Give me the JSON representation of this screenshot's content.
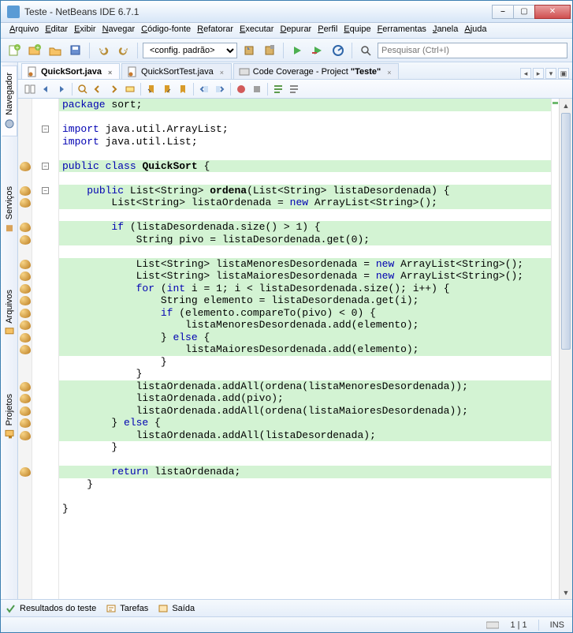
{
  "window_title": "Teste - NetBeans IDE 6.7.1",
  "menu": [
    "Arquivo",
    "Editar",
    "Exibir",
    "Navegar",
    "Código-fonte",
    "Refatorar",
    "Executar",
    "Depurar",
    "Perfil",
    "Equipe",
    "Ferramentas",
    "Janela",
    "Ajuda"
  ],
  "config_label": "<config. padrão>",
  "search_placeholder": "Pesquisar (Ctrl+I)",
  "side_tabs": [
    "Navegador",
    "Serviços",
    "Arquivos",
    "Projetos"
  ],
  "editor_tabs": [
    {
      "label": "QuickSort.java",
      "active": true
    },
    {
      "label": "QuickSortTest.java",
      "active": false
    },
    {
      "label": "Code Coverage - Project \"Teste\"",
      "active": false,
      "rich_prefix": "Code Coverage - Project ",
      "rich_bold": "\"Teste\""
    }
  ],
  "bottom_tabs": [
    "Resultados do teste",
    "Tarefas",
    "Saída"
  ],
  "status": {
    "pos": "1 | 1",
    "mode": "INS"
  },
  "code_lines": [
    {
      "hl": true,
      "tokens": [
        [
          "kw",
          "package"
        ],
        [
          "",
          " sort;"
        ]
      ]
    },
    {
      "hl": false,
      "tokens": [
        [
          "",
          ""
        ]
      ]
    },
    {
      "hl": false,
      "tokens": [
        [
          "kw",
          "import"
        ],
        [
          "",
          " java.util.ArrayList;"
        ]
      ]
    },
    {
      "hl": false,
      "tokens": [
        [
          "kw",
          "import"
        ],
        [
          "",
          " java.util.List;"
        ]
      ]
    },
    {
      "hl": false,
      "tokens": [
        [
          "",
          ""
        ]
      ]
    },
    {
      "hl": true,
      "tokens": [
        [
          "kw",
          "public"
        ],
        [
          "",
          " "
        ],
        [
          "kw",
          "class"
        ],
        [
          "",
          " "
        ],
        [
          "cls",
          "QuickSort"
        ],
        [
          "",
          " {"
        ]
      ]
    },
    {
      "hl": false,
      "tokens": [
        [
          "",
          ""
        ]
      ]
    },
    {
      "hl": true,
      "tokens": [
        [
          "",
          "    "
        ],
        [
          "kw",
          "public"
        ],
        [
          "",
          " List<String> "
        ],
        [
          "cls",
          "ordena"
        ],
        [
          "",
          "(List<String> listaDesordenada) {"
        ]
      ]
    },
    {
      "hl": true,
      "tokens": [
        [
          "",
          "        List<String> listaOrdenada = "
        ],
        [
          "kw",
          "new"
        ],
        [
          "",
          " ArrayList<String>();"
        ]
      ]
    },
    {
      "hl": false,
      "tokens": [
        [
          "",
          ""
        ]
      ]
    },
    {
      "hl": true,
      "tokens": [
        [
          "",
          "        "
        ],
        [
          "kw",
          "if"
        ],
        [
          "",
          " (listaDesordenada.size() > 1) {"
        ]
      ]
    },
    {
      "hl": true,
      "tokens": [
        [
          "",
          "            String pivo = listaDesordenada.get(0);"
        ]
      ]
    },
    {
      "hl": false,
      "tokens": [
        [
          "",
          ""
        ]
      ]
    },
    {
      "hl": true,
      "tokens": [
        [
          "",
          "            List<String> listaMenoresDesordenada = "
        ],
        [
          "kw",
          "new"
        ],
        [
          "",
          " ArrayList<String>();"
        ]
      ]
    },
    {
      "hl": true,
      "tokens": [
        [
          "",
          "            List<String> listaMaioresDesordenada = "
        ],
        [
          "kw",
          "new"
        ],
        [
          "",
          " ArrayList<String>();"
        ]
      ]
    },
    {
      "hl": true,
      "tokens": [
        [
          "",
          "            "
        ],
        [
          "kw",
          "for"
        ],
        [
          "",
          " ("
        ],
        [
          "kw",
          "int"
        ],
        [
          "",
          " i = 1; i < listaDesordenada.size(); i++) {"
        ]
      ]
    },
    {
      "hl": true,
      "tokens": [
        [
          "",
          "                String elemento = listaDesordenada.get(i);"
        ]
      ]
    },
    {
      "hl": true,
      "tokens": [
        [
          "",
          "                "
        ],
        [
          "kw",
          "if"
        ],
        [
          "",
          " (elemento.compareTo(pivo) < 0) {"
        ]
      ]
    },
    {
      "hl": true,
      "tokens": [
        [
          "",
          "                    listaMenoresDesordenada.add(elemento);"
        ]
      ]
    },
    {
      "hl": true,
      "tokens": [
        [
          "",
          "                } "
        ],
        [
          "kw",
          "else"
        ],
        [
          "",
          " {"
        ]
      ]
    },
    {
      "hl": true,
      "tokens": [
        [
          "",
          "                    listaMaioresDesordenada.add(elemento);"
        ]
      ]
    },
    {
      "hl": false,
      "tokens": [
        [
          "",
          "                }"
        ]
      ]
    },
    {
      "hl": false,
      "tokens": [
        [
          "",
          "            }"
        ]
      ]
    },
    {
      "hl": true,
      "tokens": [
        [
          "",
          "            listaOrdenada.addAll(ordena(listaMenoresDesordenada));"
        ]
      ]
    },
    {
      "hl": true,
      "tokens": [
        [
          "",
          "            listaOrdenada.add(pivo);"
        ]
      ]
    },
    {
      "hl": true,
      "tokens": [
        [
          "",
          "            listaOrdenada.addAll(ordena(listaMaioresDesordenada));"
        ]
      ]
    },
    {
      "hl": true,
      "tokens": [
        [
          "",
          "        } "
        ],
        [
          "kw",
          "else"
        ],
        [
          "",
          " {"
        ]
      ]
    },
    {
      "hl": true,
      "tokens": [
        [
          "",
          "            listaOrdenada.addAll(listaDesordenada);"
        ]
      ]
    },
    {
      "hl": false,
      "tokens": [
        [
          "",
          "        }"
        ]
      ]
    },
    {
      "hl": false,
      "tokens": [
        [
          "",
          ""
        ]
      ]
    },
    {
      "hl": true,
      "tokens": [
        [
          "",
          "        "
        ],
        [
          "kw",
          "return"
        ],
        [
          "",
          " listaOrdenada;"
        ]
      ]
    },
    {
      "hl": false,
      "tokens": [
        [
          "",
          "    }"
        ]
      ]
    },
    {
      "hl": false,
      "tokens": [
        [
          "",
          ""
        ]
      ]
    },
    {
      "hl": false,
      "tokens": [
        [
          "",
          "}"
        ]
      ]
    }
  ],
  "glyph_lines": [
    5,
    7,
    8,
    10,
    11,
    13,
    14,
    15,
    16,
    17,
    18,
    19,
    20,
    23,
    24,
    25,
    26,
    27,
    30
  ],
  "fold_lines": [
    {
      "line": 2,
      "sym": "−"
    },
    {
      "line": 5,
      "sym": "−"
    },
    {
      "line": 7,
      "sym": "−"
    }
  ]
}
